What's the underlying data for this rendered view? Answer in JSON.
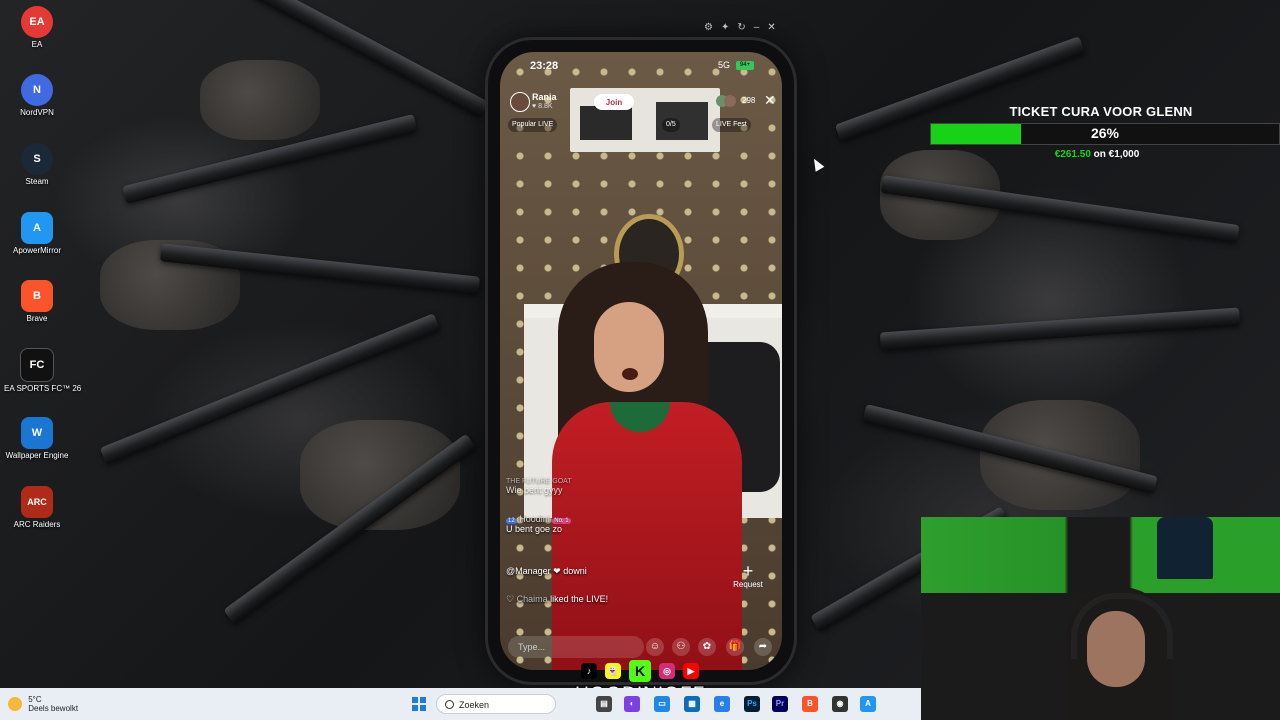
{
  "desktop": {
    "icons": [
      {
        "label": "EA",
        "glyph": "EA",
        "color": "#e53935"
      },
      {
        "label": "NordVPN",
        "glyph": "N",
        "color": "#4169e1"
      },
      {
        "label": "Steam",
        "glyph": "S",
        "color": "#1b2838"
      },
      {
        "label": "ApowerMirror",
        "glyph": "A",
        "color": "#2196f3"
      },
      {
        "label": "Brave",
        "glyph": "B",
        "color": "#fb542b"
      },
      {
        "label": "EA SPORTS FC™ 26",
        "glyph": "FC",
        "color": "#111111"
      },
      {
        "label": "Wallpaper Engine",
        "glyph": "W",
        "color": "#1976d2"
      },
      {
        "label": "ARC Raiders",
        "glyph": "ARC",
        "color": "#b02a1a"
      }
    ]
  },
  "phone": {
    "status": {
      "time": "23:28",
      "network": "5G",
      "battery": "94+"
    },
    "host": {
      "name": "Rania",
      "likes": "8.8K",
      "join_label": "Join"
    },
    "chips": {
      "popular": "Popular LIVE",
      "progress": "0/5",
      "fest": "LIVE Fest"
    },
    "viewers": "298",
    "chat": [
      {
        "user": "THE FUTURE GOAT",
        "message": "Wie bent gyyy"
      },
      {
        "user": "Hoodini",
        "level": "12",
        "rank": "No. 1",
        "message": "U bent goe zo"
      },
      {
        "user": "",
        "message": "@Manager ❤ downi"
      },
      {
        "user": "Chaima",
        "message": "liked the LIVE!"
      }
    ],
    "request_label": "Request",
    "input_placeholder": "Type..."
  },
  "goal": {
    "title": "TICKET CURA VOOR GLENN",
    "percent_label": "26%",
    "percent": 26,
    "raised": "€261.50",
    "of": "on €1,000",
    "color": "#18d218"
  },
  "stream": {
    "handle": "HOODINIOFF"
  },
  "taskbar": {
    "weather_temp": "5°C",
    "weather_desc": "Deels bewolkt",
    "search_placeholder": "Zoeken"
  }
}
